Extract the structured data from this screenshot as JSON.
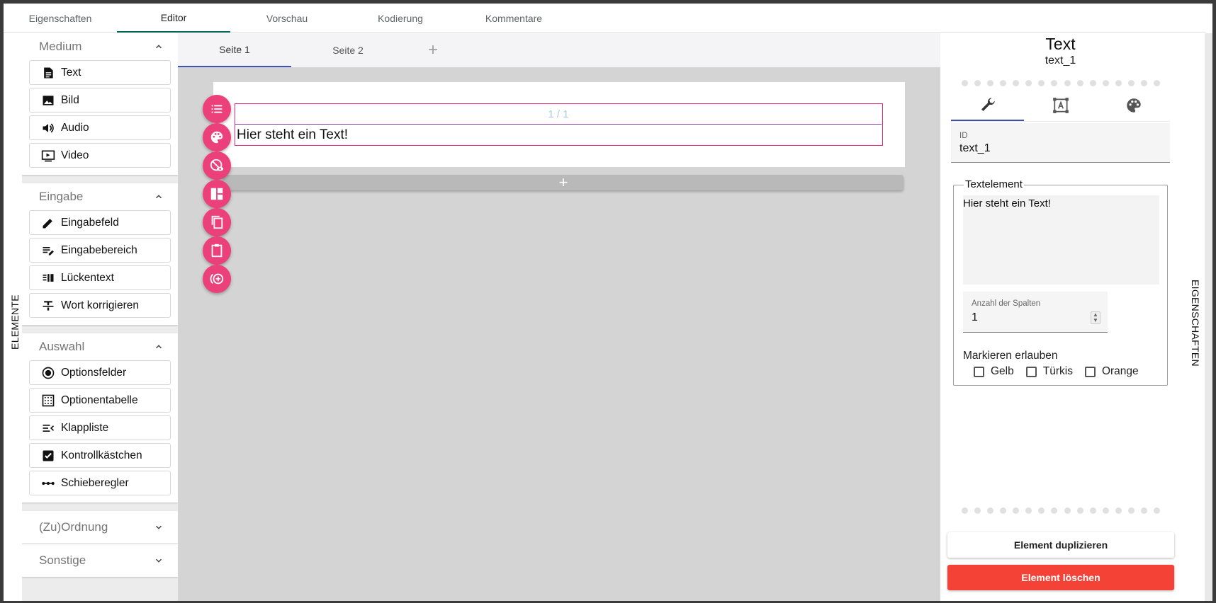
{
  "top_tabs": [
    {
      "label": "Eigenschaften"
    },
    {
      "label": "Editor"
    },
    {
      "label": "Vorschau"
    },
    {
      "label": "Kodierung"
    },
    {
      "label": "Kommentare"
    }
  ],
  "left_label": "ELEMENTE",
  "right_label": "EIGENSCHAFTEN",
  "groups": {
    "medium": {
      "title": "Medium",
      "items": [
        {
          "label": "Text"
        },
        {
          "label": "Bild"
        },
        {
          "label": "Audio"
        },
        {
          "label": "Video"
        }
      ]
    },
    "eingabe": {
      "title": "Eingabe",
      "items": [
        {
          "label": "Eingabefeld"
        },
        {
          "label": "Eingabebereich"
        },
        {
          "label": "Lückentext"
        },
        {
          "label": "Wort korrigieren"
        }
      ]
    },
    "auswahl": {
      "title": "Auswahl",
      "items": [
        {
          "label": "Optionsfelder"
        },
        {
          "label": "Optionentabelle"
        },
        {
          "label": "Klappliste"
        },
        {
          "label": "Kontrollkästchen"
        },
        {
          "label": "Schieberegler"
        }
      ]
    },
    "zuordnung": {
      "title": "(Zu)Ordnung"
    },
    "sonstige": {
      "title": "Sonstige"
    }
  },
  "page_tabs": [
    {
      "label": "Seite 1"
    },
    {
      "label": "Seite 2"
    }
  ],
  "page_add": "+",
  "section": {
    "counter": "1 / 1",
    "text": "Hier steht ein Text!"
  },
  "add_section": "+",
  "right": {
    "title": "Text",
    "subtitle": "text_1",
    "id_label": "ID",
    "id_value": "text_1",
    "fieldset_legend": "Textelement",
    "textarea_value": "Hier steht ein Text!",
    "columns_label": "Anzahl der Spalten",
    "columns_value": "1",
    "mark_label": "Markieren erlauben",
    "checks": [
      {
        "label": "Gelb"
      },
      {
        "label": "Türkis"
      },
      {
        "label": "Orange"
      }
    ],
    "duplicate": "Element duplizieren",
    "delete": "Element löschen"
  },
  "colors": {
    "accent": "#ec407a",
    "delete": "#f44336",
    "tab_indicator": "#3f51b5",
    "selection": "#e0287d"
  },
  "icons": [
    "text-icon",
    "image-icon",
    "audio-icon",
    "video-icon",
    "pencil-icon",
    "edit-note-icon",
    "cloze-icon",
    "strikethrough-icon",
    "radio-icon",
    "grid-icon",
    "dropdown-list-icon",
    "checkbox-icon",
    "slider-icon",
    "wrench-icon",
    "position-icon",
    "palette-icon"
  ]
}
